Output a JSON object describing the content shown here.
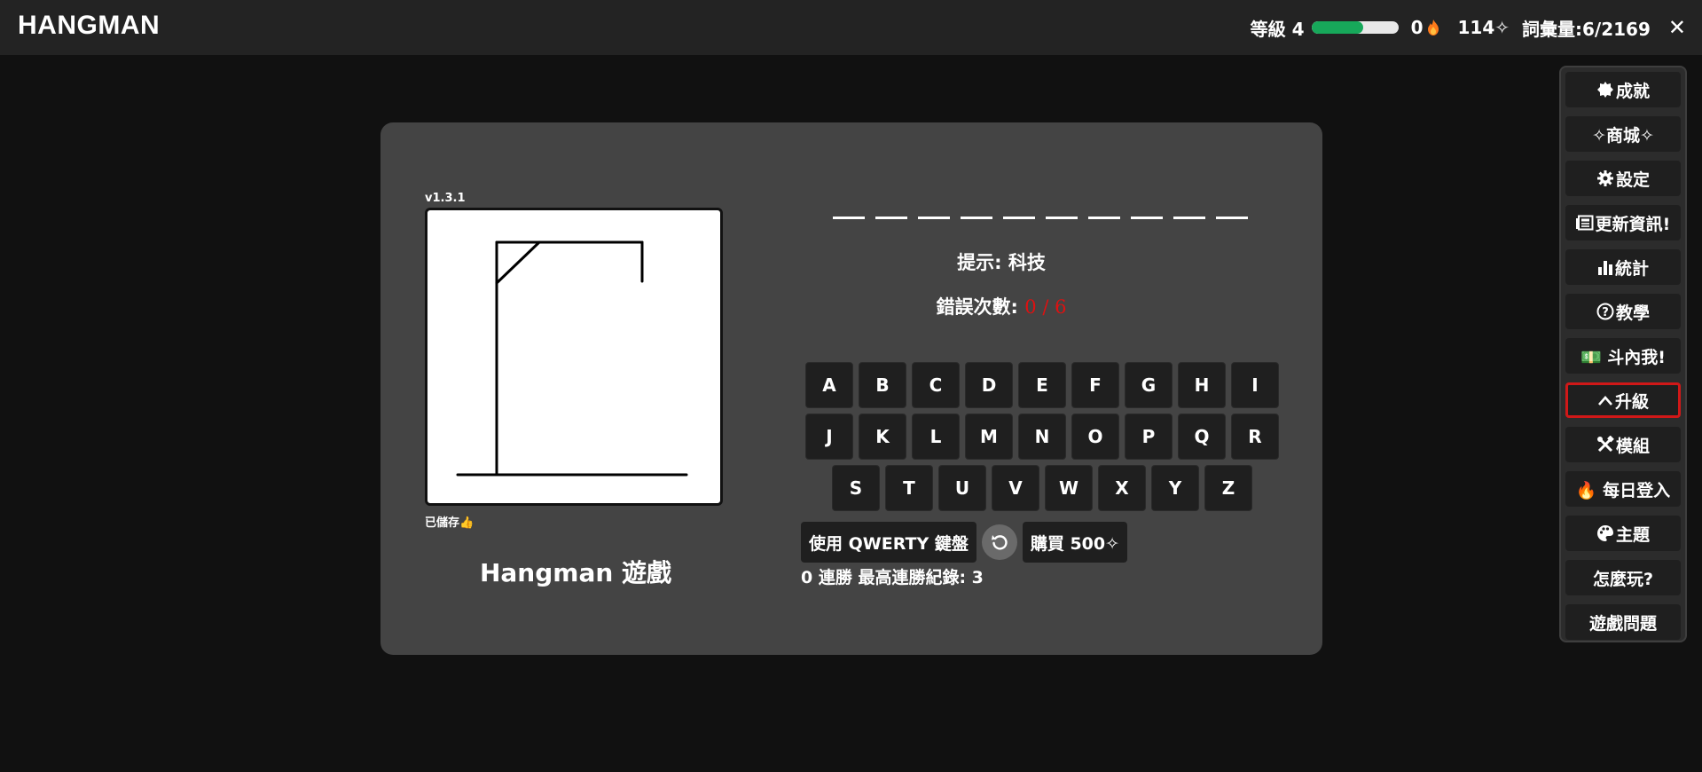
{
  "header": {
    "title": "HANGMAN",
    "level_label": "等級 4",
    "level_progress_percent": 60,
    "streak_days": "0",
    "points": "114✧",
    "vocab_label": "詞彙量:6/2169"
  },
  "game": {
    "version": "v1.3.1",
    "saved_label": "已儲存👍",
    "title": "Hangman 遊戲",
    "word_length": 10,
    "hint_label": "提示: 科技",
    "errors_label": "錯誤次數: ",
    "errors_count": "0 / 6",
    "keyboard_rows": [
      [
        "A",
        "B",
        "C",
        "D",
        "E",
        "F",
        "G",
        "H",
        "I"
      ],
      [
        "J",
        "K",
        "L",
        "M",
        "N",
        "O",
        "P",
        "Q",
        "R"
      ],
      [
        "S",
        "T",
        "U",
        "V",
        "W",
        "X",
        "Y",
        "Z"
      ]
    ],
    "qwerty_button": "使用 QWERTY 鍵盤",
    "buy_button": "購買 500✧",
    "streak_text": "0 連勝 最高連勝紀錄: 3"
  },
  "sidebar": {
    "items": [
      {
        "label": "成就",
        "icon": "badge-icon"
      },
      {
        "label": "✧商城✧",
        "icon": ""
      },
      {
        "label": "設定",
        "icon": "gear-icon"
      },
      {
        "label": "更新資訊!",
        "icon": "newspaper-icon"
      },
      {
        "label": "統計",
        "icon": "bar-chart-icon"
      },
      {
        "label": "教學",
        "icon": "question-circle-icon"
      },
      {
        "label": "💵 斗內我!",
        "icon": ""
      },
      {
        "label": "升級",
        "icon": "chevron-up-icon"
      },
      {
        "label": "模組",
        "icon": "tools-icon"
      },
      {
        "label": "🔥 每日登入",
        "icon": ""
      },
      {
        "label": "主題",
        "icon": "palette-icon"
      },
      {
        "label": "怎麼玩?",
        "icon": ""
      },
      {
        "label": "遊戲問題",
        "icon": ""
      }
    ]
  },
  "colors": {
    "accent_green": "#17a85a",
    "error_red": "#e01010",
    "highlight_red": "#d01818",
    "flame_orange": "#ff7a1a"
  }
}
